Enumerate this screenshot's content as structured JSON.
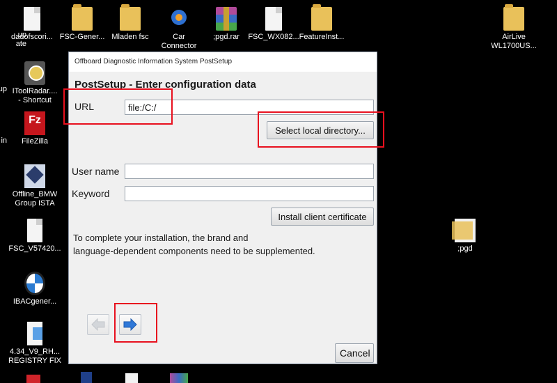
{
  "desktop": {
    "icons": [
      {
        "id": "partial-top-left",
        "label": "up\nate",
        "type": "none"
      },
      {
        "id": "dadofscori",
        "label": "dadofscori...",
        "type": "file"
      },
      {
        "id": "fsc-gener",
        "label": "FSC-Gener...",
        "type": "folder"
      },
      {
        "id": "mladen-fsc",
        "label": "Mladen fsc",
        "type": "folder"
      },
      {
        "id": "car-connector",
        "label": "Car\nConnector",
        "type": "car"
      },
      {
        "id": "pgd-rar",
        "label": ";pgd.rar",
        "type": "rar"
      },
      {
        "id": "fsc-wx082",
        "label": "FSC_WX082...",
        "type": "file"
      },
      {
        "id": "featureinst",
        "label": "FeatureInst...",
        "type": "folder"
      },
      {
        "id": "airlive",
        "label": "AirLive\nWL1700US...",
        "type": "folder"
      },
      {
        "id": "partial-up",
        "label": "up",
        "type": "none"
      },
      {
        "id": "itoolradar",
        "label": "IToolRadar....\n- Shortcut",
        "type": "itool"
      },
      {
        "id": "partial-in",
        "label": "in",
        "type": "none"
      },
      {
        "id": "filezilla",
        "label": "FileZilla",
        "type": "fz"
      },
      {
        "id": "offline-bmw",
        "label": "Offline_BMW\nGroup ISTA",
        "type": "ista"
      },
      {
        "id": "fsc-v57420",
        "label": "FSC_V57420...",
        "type": "file"
      },
      {
        "id": "ibacgener",
        "label": "IBACgener...",
        "type": "bmw"
      },
      {
        "id": "registry-fix",
        "label": "4.34_V9_RH...\nREGISTRY FIX",
        "type": "reg"
      },
      {
        "id": "pgd-folder",
        "label": ";pgd",
        "type": "folder-doc"
      }
    ]
  },
  "dialog": {
    "title": "Offboard Diagnostic Information System PostSetup",
    "heading": "PostSetup - Enter configuration data",
    "url_label": "URL",
    "url_value": "file:/C:/",
    "select_dir_label": "Select local directory...",
    "username_label": "User name",
    "username_value": "",
    "keyword_label": "Keyword",
    "keyword_value": "",
    "install_cert_label": "Install client certificate",
    "note_line1": "To complete your installation, the brand and",
    "note_line2": "language-dependent components need to be supplemented.",
    "cancel_label": "Cancel"
  },
  "colors": {
    "highlight": "#e8101e",
    "arrow_active": "#2f78d8",
    "arrow_disabled": "#c8ccd2"
  }
}
